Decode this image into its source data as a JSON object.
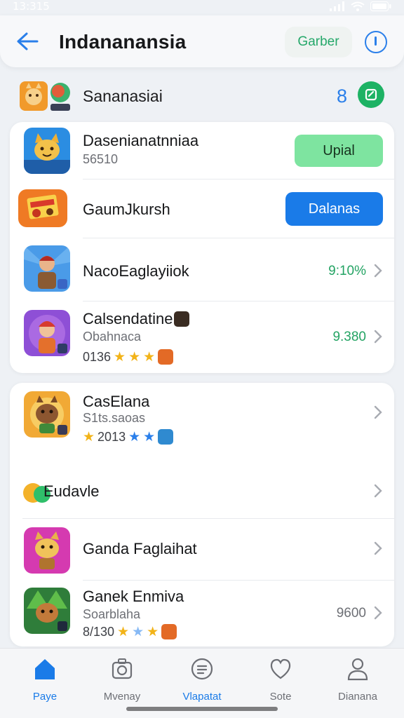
{
  "status_bar": {
    "time": "13:315",
    "icons": [
      "signal-icon",
      "wifi-icon",
      "battery-icon"
    ]
  },
  "header": {
    "title": "Indananansia",
    "chip_label": "Garber"
  },
  "group": {
    "title": "Sananasiai",
    "count": "8"
  },
  "rows": [
    {
      "title": "Dasenianatnniaa",
      "subtitle": "56510",
      "button": "Upial"
    },
    {
      "title": "GaumJkursh",
      "button": "Dalanas"
    },
    {
      "title": "NacoEaglayiiok",
      "value": "9:10%"
    },
    {
      "title": "Calsendatine",
      "subtitle": "Obahnaca",
      "meta": "0136",
      "value": "9.380"
    },
    {
      "title": "CasElana",
      "subtitle": "S1ts.saoas",
      "meta": "2013"
    },
    {
      "title": "Eudavle"
    },
    {
      "title": "Ganda Faglaihat"
    },
    {
      "title": "Ganek Enmiva",
      "subtitle": "Soarblaha",
      "meta": "8/130",
      "value": "9600"
    }
  ],
  "tabs": [
    {
      "label": "Paye",
      "icon": "home-icon",
      "active": true
    },
    {
      "label": "Mvenay",
      "icon": "camera-icon",
      "active": false
    },
    {
      "label": "Vlapatat",
      "icon": "document-icon",
      "active": true
    },
    {
      "label": "Sote",
      "icon": "heart-icon",
      "active": false
    },
    {
      "label": "Dianana",
      "icon": "person-icon",
      "active": false
    }
  ],
  "colors": {
    "accent_blue": "#1a7be8",
    "accent_green": "#1db264",
    "button_green": "#7ee4a0",
    "background": "#eef1f5"
  }
}
